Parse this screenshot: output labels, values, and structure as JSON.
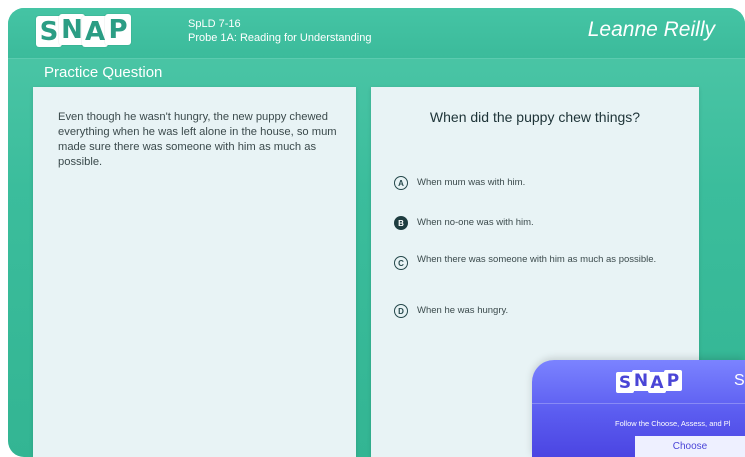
{
  "header": {
    "logo_letters": [
      "S",
      "N",
      "A",
      "P"
    ],
    "course": "SpLD 7-16",
    "probe": "Probe 1A: Reading for Understanding",
    "teacher_name": "Leanne Reilly"
  },
  "section_title": "Practice Question",
  "passage": "Even though he wasn't hungry, the new puppy chewed everything when he was left alone in the house, so mum made sure there was someone with him as much as possible.",
  "question": "When did the puppy chew things?",
  "options": [
    {
      "letter": "A",
      "text": "When mum was with him.",
      "selected": false
    },
    {
      "letter": "B",
      "text": "When no-one was with him.",
      "selected": true
    },
    {
      "letter": "C",
      "text": "When there was someone with him as much as possible.",
      "selected": false
    },
    {
      "letter": "D",
      "text": "When he was hungry.",
      "selected": false
    }
  ],
  "popup": {
    "logo_letters": [
      "S",
      "N",
      "A",
      "P"
    ],
    "trailing_letter": "S",
    "text": "Follow the Choose, Assess, and Pl",
    "button_label": "Choose"
  },
  "colors": {
    "background_teal": "#3bbd9c",
    "panel": "#e8f3f5",
    "popup_purple": "#5b5cf0",
    "selected_option": "#1f3d40"
  }
}
